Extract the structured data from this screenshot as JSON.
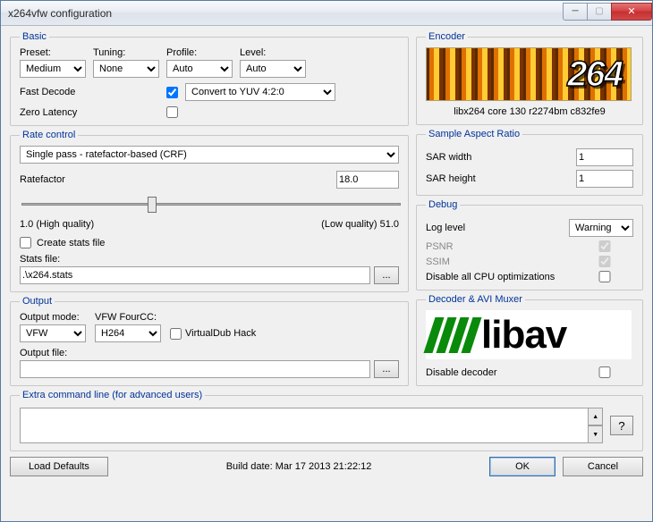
{
  "window": {
    "title": "x264vfw configuration"
  },
  "basic": {
    "legend": "Basic",
    "preset_label": "Preset:",
    "preset_value": "Medium",
    "tuning_label": "Tuning:",
    "tuning_value": "None",
    "profile_label": "Profile:",
    "profile_value": "Auto",
    "level_label": "Level:",
    "level_value": "Auto",
    "fast_decode_label": "Fast Decode",
    "fast_decode_checked": true,
    "colorspace_value": "Convert to YUV 4:2:0",
    "zero_latency_label": "Zero Latency",
    "zero_latency_checked": false
  },
  "encoder": {
    "legend": "Encoder",
    "logo_text": "264",
    "caption": "libx264 core 130 r2274bm c832fe9"
  },
  "rate_control": {
    "legend": "Rate control",
    "mode_value": "Single pass - ratefactor-based (CRF)",
    "ratefactor_label": "Ratefactor",
    "ratefactor_value": "18.0",
    "slider_min": 1.0,
    "slider_max": 51.0,
    "slider_value": 18.0,
    "quality_high": "1.0 (High quality)",
    "quality_low": "(Low quality) 51.0",
    "create_stats_label": "Create stats file",
    "create_stats_checked": false,
    "stats_file_label": "Stats file:",
    "stats_file_value": ".\\x264.stats",
    "browse_label": "..."
  },
  "sar": {
    "legend": "Sample Aspect Ratio",
    "width_label": "SAR width",
    "width_value": "1",
    "height_label": "SAR height",
    "height_value": "1"
  },
  "debug": {
    "legend": "Debug",
    "log_level_label": "Log level",
    "log_level_value": "Warning",
    "psnr_label": "PSNR",
    "psnr_checked": true,
    "ssim_label": "SSIM",
    "ssim_checked": true,
    "disable_cpu_label": "Disable all CPU optimizations",
    "disable_cpu_checked": false
  },
  "output": {
    "legend": "Output",
    "mode_label": "Output mode:",
    "mode_value": "VFW",
    "fourcc_label": "VFW FourCC:",
    "fourcc_value": "H264",
    "vdub_hack_label": "VirtualDub Hack",
    "vdub_hack_checked": false,
    "file_label": "Output file:",
    "file_value": "",
    "browse_label": "..."
  },
  "decoder": {
    "legend": "Decoder & AVI Muxer",
    "logo_text": "libav",
    "disable_label": "Disable decoder",
    "disable_checked": false
  },
  "extra": {
    "legend": "Extra command line (for advanced users)",
    "value": "",
    "help_label": "?"
  },
  "bottom": {
    "load_defaults": "Load Defaults",
    "build_date": "Build date: Mar 17 2013 21:22:12",
    "ok": "OK",
    "cancel": "Cancel"
  }
}
